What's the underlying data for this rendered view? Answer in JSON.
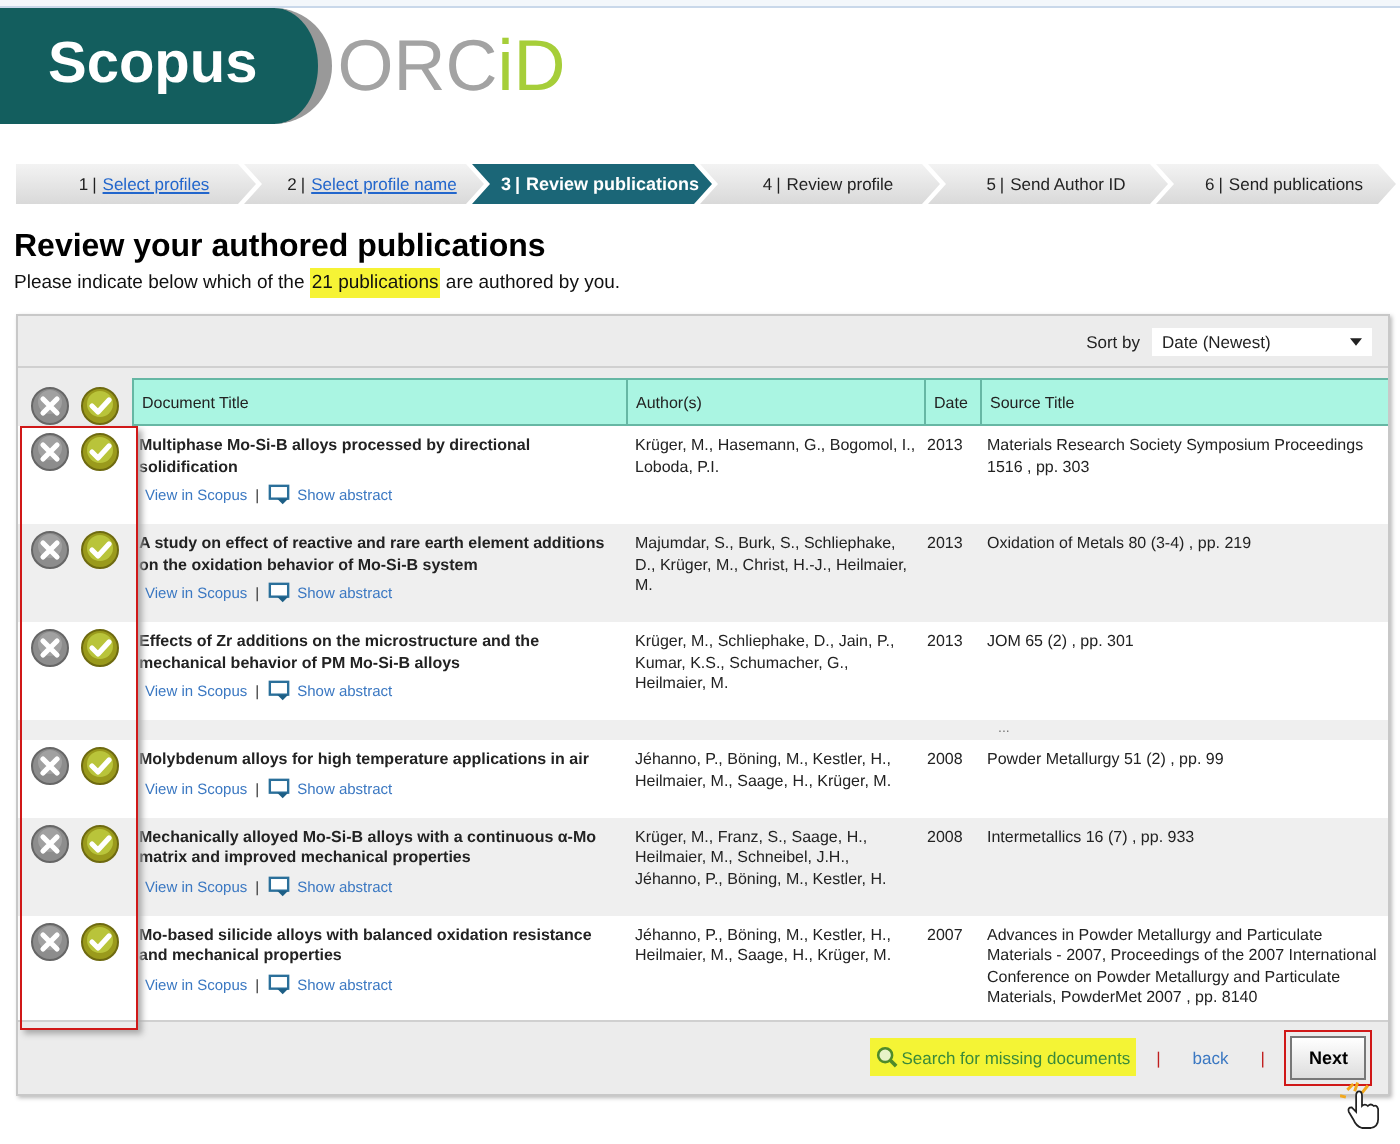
{
  "logo": {
    "scopus": "Scopus",
    "orcid_gray": "ORC",
    "orcid_green": "iD"
  },
  "steps": [
    {
      "number": "1",
      "label": "Select profiles",
      "completed": true,
      "selected": false
    },
    {
      "number": "2",
      "label": "Select profile name",
      "completed": true,
      "selected": false
    },
    {
      "number": "3",
      "label": "Review publications",
      "completed": false,
      "selected": true
    },
    {
      "number": "4",
      "label": "Review profile",
      "completed": false,
      "selected": false
    },
    {
      "number": "5",
      "label": "Send Author ID",
      "completed": false,
      "selected": false
    },
    {
      "number": "6",
      "label": "Send publications",
      "completed": false,
      "selected": false
    }
  ],
  "step_separator": "|",
  "link_separator": "|",
  "heading": "Review your authored publications",
  "intro": {
    "before": "Please indicate below which of the ",
    "highlight": "21 publications",
    "after": " are authored by you."
  },
  "sort": {
    "label": "Sort by",
    "value": "Date (Newest)"
  },
  "table": {
    "columns": [
      "Document Title",
      "Author(s)",
      "Date",
      "Source Title"
    ],
    "rows": [
      {
        "kind": "publication",
        "title": "Multiphase Mo-Si-B alloys processed by directional solidification",
        "view": "View in Scopus",
        "abstract": "Show abstract",
        "authors": "Krüger, M., Hasemann, G., Bogomol, I., Loboda, P.I.",
        "date": "2013",
        "source": "Materials Research Society Symposium Proceedings 1516 , pp. 303"
      },
      {
        "kind": "publication",
        "title": "A study on effect of reactive and rare earth element additions on the oxidation behavior of Mo-Si-B system",
        "view": "View in Scopus",
        "abstract": "Show abstract",
        "authors": "Majumdar, S., Burk, S., Schliephake, D., Krüger, M., Christ, H.-J., Heilmaier, M.",
        "date": "2013",
        "source": "Oxidation of Metals 80 (3-4) , pp. 219"
      },
      {
        "kind": "publication",
        "title": "Effects of Zr additions on the microstructure and the mechanical behavior of PM Mo-Si-B alloys",
        "view": "View in Scopus",
        "abstract": "Show abstract",
        "authors": "Krüger, M., Schliephake, D., Jain, P., Kumar, K.S., Schumacher, G., Heilmaier, M.",
        "date": "2013",
        "source": "JOM 65 (2) , pp. 301"
      },
      {
        "kind": "gap",
        "mark": "..."
      },
      {
        "kind": "publication",
        "title": "Molybdenum alloys for high temperature applications in air",
        "view": "View in Scopus",
        "abstract": "Show abstract",
        "authors": "Jéhanno, P., Böning, M., Kestler, H., Heilmaier, M., Saage, H., Krüger, M.",
        "date": "2008",
        "source": "Powder Metallurgy 51 (2) , pp. 99"
      },
      {
        "kind": "publication",
        "title": "Mechanically alloyed Mo-Si-B alloys with a continuous α-Mo matrix and improved mechanical properties",
        "view": "View in Scopus",
        "abstract": "Show abstract",
        "authors": "Krüger, M., Franz, S., Saage, H., Heilmaier, M., Schneibel, J.H., Jéhanno, P., Böning, M., Kestler, H.",
        "date": "2008",
        "source": "Intermetallics 16 (7) , pp. 933"
      },
      {
        "kind": "publication",
        "title": "Mo-based silicide alloys with balanced oxidation resistance and mechanical properties",
        "view": "View in Scopus",
        "abstract": "Show abstract",
        "authors": "Jéhanno, P., Böning, M., Kestler, H., Heilmaier, M., Saage, H., Krüger, M.",
        "date": "2007",
        "source": "Advances in Powder Metallurgy and Particulate Materials - 2007, Proceedings of the 2007 International Conference on Powder Metallurgy and Particulate Materials, PowderMet 2007 , pp. 8140"
      }
    ]
  },
  "footer": {
    "search": "Search for missing documents",
    "separator": "|",
    "back": "back",
    "next": "Next"
  }
}
